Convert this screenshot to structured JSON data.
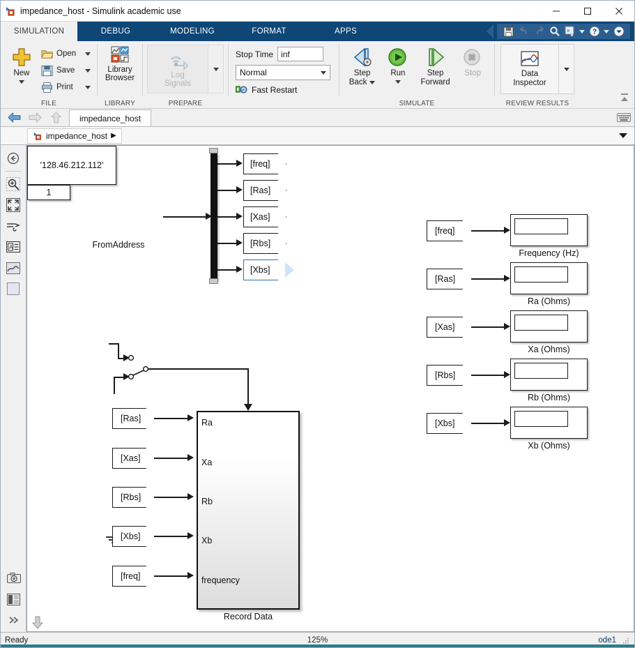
{
  "window": {
    "title": "impedance_host - Simulink academic use",
    "app_icon": "simulink-model-icon",
    "minimize": "–",
    "maximize": "□",
    "close": "✕"
  },
  "ribbon": {
    "tabs": [
      {
        "label": "SIMULATION",
        "active": true
      },
      {
        "label": "DEBUG",
        "active": false
      },
      {
        "label": "MODELING",
        "active": false
      },
      {
        "label": "FORMAT",
        "active": false
      },
      {
        "label": "APPS",
        "active": false
      }
    ],
    "quick_access": [
      {
        "name": "save-icon",
        "glyph": "💾"
      },
      {
        "name": "undo-icon",
        "glyph": "↶"
      },
      {
        "name": "redo-icon",
        "glyph": "↷"
      },
      {
        "name": "search-icon",
        "glyph": "🔍"
      },
      {
        "name": "favorites-icon",
        "glyph": "»"
      },
      {
        "name": "help-icon",
        "glyph": "?"
      },
      {
        "name": "expand-icon",
        "glyph": "▼"
      }
    ],
    "groups": {
      "file": {
        "title": "FILE",
        "new_label": "New",
        "open_label": "Open",
        "save_label": "Save",
        "print_label": "Print"
      },
      "library": {
        "title": "LIBRARY",
        "library_browser_label": "Library\nBrowser",
        "library_browser_line1": "Library",
        "library_browser_line2": "Browser"
      },
      "prepare": {
        "title": "PREPARE",
        "log_signals_line1": "Log",
        "log_signals_line2": "Signals",
        "enabled": false
      },
      "simulate_settings": {
        "stop_time_label": "Stop Time",
        "stop_time_value": "inf",
        "mode_value": "Normal",
        "fast_restart_label": "Fast Restart"
      },
      "simulate": {
        "title": "SIMULATE",
        "step_back_line1": "Step",
        "step_back_line2": "Back",
        "run_label": "Run",
        "step_forward_line1": "Step",
        "step_forward_line2": "Forward",
        "stop_label": "Stop",
        "stop_enabled": false
      },
      "review": {
        "title": "REVIEW RESULTS",
        "data_inspector_line1": "Data",
        "data_inspector_line2": "Inspector"
      }
    },
    "collapse_icon": "collapse-ribbon-icon"
  },
  "doc_tabs": {
    "back_icon": "back-arrow-icon",
    "forward_icon": "forward-arrow-icon",
    "up_icon": "up-arrow-icon",
    "tabs": [
      {
        "label": "impedance_host",
        "active": true
      }
    ],
    "keyboard_icon": "keyboard-icon"
  },
  "breadcrumb": {
    "back_icon": "navigate-back-icon",
    "model_icon": "simulink-model-icon",
    "path": "impedance_host",
    "separator": "▶"
  },
  "left_toolbar": {
    "items": [
      {
        "name": "navigate-back-icon"
      },
      {
        "name": "zoom-in-icon"
      },
      {
        "name": "fit-to-view-icon"
      },
      {
        "name": "signal-routing-icon"
      },
      {
        "name": "annotation-icon"
      },
      {
        "name": "image-icon"
      },
      {
        "name": "area-icon"
      }
    ],
    "bottom_items": [
      {
        "name": "camera-icon"
      },
      {
        "name": "layout-icon"
      },
      {
        "name": "expand-chevrons-icon"
      }
    ]
  },
  "canvas": {
    "from_address": {
      "value": "'128.46.212.112'",
      "caption": "FromAddress"
    },
    "demux_goto_tags": [
      {
        "label": "[freq]",
        "selected": false
      },
      {
        "label": "[Ras]",
        "selected": false
      },
      {
        "label": "[Xas]",
        "selected": false
      },
      {
        "label": "[Rbs]",
        "selected": false
      },
      {
        "label": "[Xbs]",
        "selected": true
      }
    ],
    "constant": {
      "value": "1"
    },
    "switch": {
      "name": "manual-switch"
    },
    "ground": {
      "name": "ground-block"
    },
    "record_data": {
      "caption": "Record Data",
      "ports": [
        "Ra",
        "Xa",
        "Rb",
        "Xb",
        "frequency"
      ],
      "from_tags": [
        "[Ras]",
        "[Xas]",
        "[Rbs]",
        "[Xbs]",
        "[freq]"
      ],
      "enable_port": "enable"
    },
    "displays": [
      {
        "tag": "[freq]",
        "caption": "Frequency (Hz)",
        "value": ""
      },
      {
        "tag": "[Ras]",
        "caption": "Ra (Ohms)",
        "value": ""
      },
      {
        "tag": "[Xas]",
        "caption": "Xa (Ohms)",
        "value": ""
      },
      {
        "tag": "[Rbs]",
        "caption": "Rb (Ohms)",
        "value": ""
      },
      {
        "tag": "[Xbs]",
        "caption": "Xb (Ohms)",
        "value": ""
      }
    ],
    "view_caret": "▼"
  },
  "status": {
    "state": "Ready",
    "zoom": "125%",
    "solver": "ode1"
  },
  "colors": {
    "ribbon_blue": "#0e4676",
    "active_tab_bg": "#f0f0f0",
    "accent_green": "#4a9a28",
    "selection_blue": "#2f6fb5"
  }
}
